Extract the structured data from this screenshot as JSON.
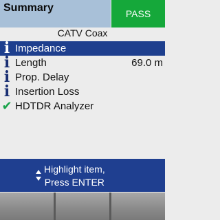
{
  "header": {
    "title": "Summary",
    "status": "PASS",
    "status_color": "#15a83a"
  },
  "subtitle": "CATV Coax",
  "items": [
    {
      "icon": "info-icon",
      "label": "Impedance",
      "value": "",
      "selected": true
    },
    {
      "icon": "info-icon",
      "label": "Length",
      "value": "69.0 m",
      "selected": false
    },
    {
      "icon": "info-icon",
      "label": "Prop. Delay",
      "value": "",
      "selected": false
    },
    {
      "icon": "info-icon",
      "label": "Insertion Loss",
      "value": "",
      "selected": false
    },
    {
      "icon": "check-icon",
      "label": "HDTDR Analyzer",
      "value": "",
      "selected": false
    }
  ],
  "prompt": {
    "icon": "up-down-arrows-icon",
    "text": "Highlight item,\nPress ENTER"
  },
  "softkeys": [
    "",
    "",
    ""
  ],
  "colors": {
    "header_bg": "#a8c0d8",
    "selection": "#1e3f8e",
    "prompt_bg": "#1f3f90"
  }
}
